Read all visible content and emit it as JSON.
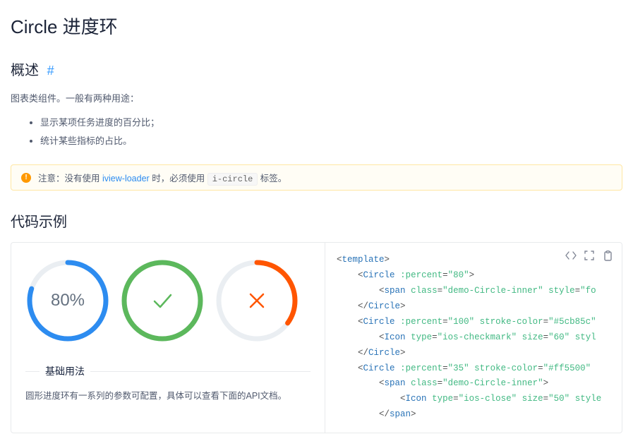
{
  "title": "Circle 进度环",
  "overview": {
    "heading": "概述",
    "anchor": "#",
    "desc": "图表类组件。一般有两种用途：",
    "bullets": [
      "显示某项任务进度的百分比；",
      "统计某些指标的占比。"
    ]
  },
  "alert": {
    "prefix": "注意：没有使用",
    "link": "iview-loader",
    "mid": "时，必须使用",
    "code": "i-circle",
    "suffix": "标签。"
  },
  "examples_heading": "代码示例",
  "demo": {
    "title": "基础用法",
    "desc": "圆形进度环有一系列的参数可配置，具体可以查看下面的API文档。",
    "circles": [
      {
        "percent": 80,
        "color": "#2d8cf0",
        "label": "80%",
        "type": "text"
      },
      {
        "percent": 100,
        "color": "#5cb85c",
        "type": "check"
      },
      {
        "percent": 35,
        "color": "#ff5500",
        "type": "close"
      }
    ]
  },
  "code": {
    "l1_tag": "template",
    "l2_tag": "Circle",
    "l2_attr": ":percent",
    "l2_val": "\"80\"",
    "l3_tag": "span",
    "l3_a1": "class",
    "l3_v1": "\"demo-Circle-inner\"",
    "l3_a2": "style",
    "l3_v2": "\"fo",
    "l4_tag": "Circle",
    "l5_tag": "Circle",
    "l5_a1": ":percent",
    "l5_v1": "\"100\"",
    "l5_a2": "stroke-color",
    "l5_v2": "\"#5cb85c\"",
    "l6_tag": "Icon",
    "l6_a1": "type",
    "l6_v1": "\"ios-checkmark\"",
    "l6_a2": "size",
    "l6_v2": "\"60\"",
    "l6_a3": "styl",
    "l7_tag": "Circle",
    "l8_tag": "Circle",
    "l8_a1": ":percent",
    "l8_v1": "\"35\"",
    "l8_a2": "stroke-color",
    "l8_v2": "\"#ff5500\"",
    "l9_tag": "span",
    "l9_a1": "class",
    "l9_v1": "\"demo-Circle-inner\"",
    "l10_tag": "Icon",
    "l10_a1": "type",
    "l10_v1": "\"ios-close\"",
    "l10_a2": "size",
    "l10_v2": "\"50\"",
    "l10_a3": "style",
    "l11_tag": "span"
  }
}
